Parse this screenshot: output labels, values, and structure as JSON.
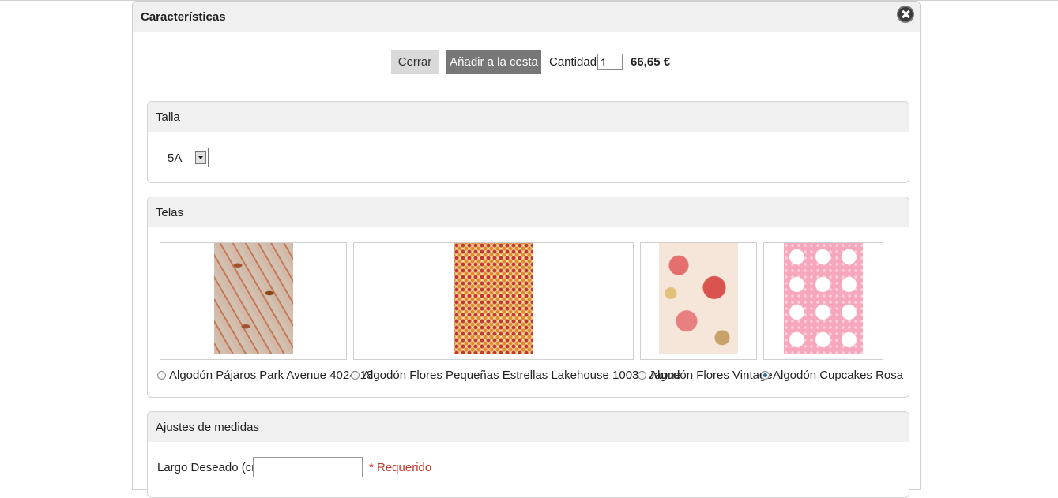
{
  "dialog": {
    "title": "Características"
  },
  "actions": {
    "close_label": "Cerrar",
    "add_label": "Añadir a la cesta",
    "quantity_label": "Cantidad:",
    "quantity_value": "1",
    "price": "66,65 €"
  },
  "talla": {
    "title": "Talla",
    "selected": "5A"
  },
  "telas": {
    "title": "Telas",
    "options": [
      {
        "label": "Algodón Pájaros Park Avenue 4024-13",
        "checked": false
      },
      {
        "label": "Algodón Flores Pequeñas Estrellas Lakehouse 10038 Jaune",
        "checked": false
      },
      {
        "label": "Algodón Flores Vintage",
        "checked": false
      },
      {
        "label": "Algodón Cupcakes Rosa",
        "checked": true
      }
    ]
  },
  "ajustes": {
    "title": "Ajustes de medidas",
    "field_label": "Largo Deseado (cm)",
    "field_value": "",
    "required_text": "* Requerido"
  }
}
